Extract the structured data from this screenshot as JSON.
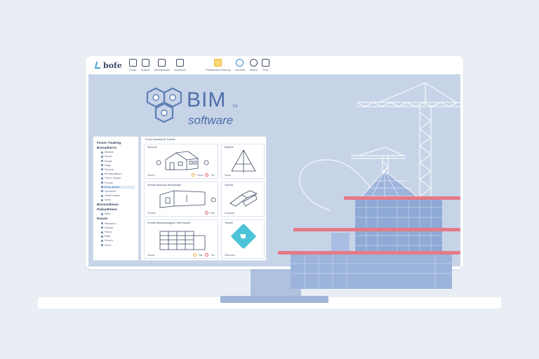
{
  "toolbar": {
    "logo_text": "bofe",
    "tools": [
      {
        "label": "Fome",
        "icon": "document-icon"
      },
      {
        "label": "Srtqoel",
        "icon": "edit-icon"
      },
      {
        "label": "Smeltaorads",
        "icon": "layers-icon"
      },
      {
        "label": "Smetsure",
        "icon": "home-icon"
      },
      {
        "label": "Pnidaeiadn Sbanrrg",
        "icon": "star-icon"
      },
      {
        "label": "Sonrbee",
        "icon": "settings-icon"
      },
      {
        "label": "Stolbe",
        "icon": "gear-icon"
      },
      {
        "label": "Floit",
        "icon": "share-icon"
      }
    ]
  },
  "hero": {
    "title": "BIM",
    "superscript": "ru",
    "subtitle": "software"
  },
  "sidebar": {
    "sections": [
      {
        "title": "Fmoes Tmaleng",
        "items": []
      },
      {
        "title": "Bxesadtivrss",
        "items": [
          "Mimedt",
          "Svooe",
          "Bopan",
          "Flbgt",
          "Flescon",
          "Beurdecaltrant"
        ]
      },
      {
        "title": "",
        "items": [
          "Thenc Oamur",
          "Fmooe",
          "Bnoe dheoel"
        ]
      },
      {
        "title": "",
        "items": [
          "Soomene",
          "Ooaf Koedeo",
          "Uoas"
        ]
      },
      {
        "title": "Bioesmdtenes",
        "items": []
      },
      {
        "title": "Psdsadtmees",
        "items": [
          "Plias"
        ]
      },
      {
        "title": "Rsoots",
        "items": [
          "Rdonmon",
          "Veoose",
          "Fleeol",
          "Rliidi",
          "Srocch",
          "Fleoe"
        ]
      }
    ],
    "selected": "Bnoe dheoel"
  },
  "panel": {
    "header": "Fmos Oaoirky^rt1 Faceta",
    "cards": [
      {
        "title": "Sixnons",
        "foot": "Seons",
        "actions": [
          "Rzun",
          "Tbs"
        ]
      },
      {
        "title": "Bdxnns",
        "foot": "Slaos",
        "actions": []
      },
      {
        "title": "Snroas fhiscrcce fbreoesaee",
        "foot": "Snsdes",
        "actions": [
          "Flbs"
        ]
      },
      {
        "title": "Soenor",
        "foot": "Sonasas",
        "actions": []
      },
      {
        "title": "Pmose bfooranesdgenn  Sbe Bnnsnt",
        "foot": "Sosas",
        "actions": [
          "Flan",
          "Tbs"
        ]
      },
      {
        "title": "Tboree",
        "foot": "Senmons",
        "actions": []
      }
    ]
  },
  "colors": {
    "accent": "#4f6fa8",
    "slab": "#e57a86",
    "glass": "#8fa9d6",
    "app_icon": "#4cc3d6"
  }
}
